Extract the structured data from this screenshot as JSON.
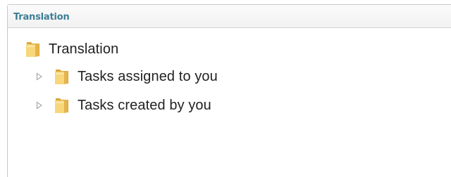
{
  "panel": {
    "title": "Translation"
  },
  "tree": {
    "root": {
      "label": "Translation",
      "icon": "folder-icon"
    },
    "children": [
      {
        "label": "Tasks assigned to you",
        "icon": "folder-icon",
        "expander_icon": "expand-triangle-icon"
      },
      {
        "label": "Tasks created by you",
        "icon": "folder-icon",
        "expander_icon": "expand-triangle-icon"
      }
    ]
  },
  "colors": {
    "title": "#3c7f95",
    "folder_light": "#f7d77a",
    "folder_dark": "#d9a53a",
    "expander": "#9a9a9a"
  }
}
